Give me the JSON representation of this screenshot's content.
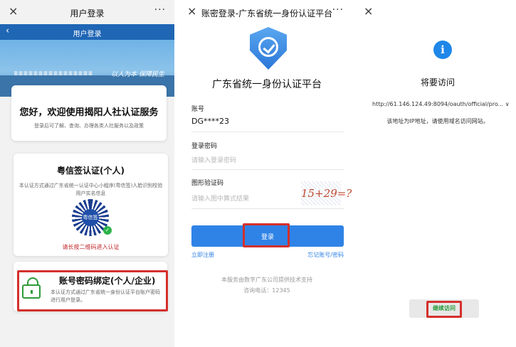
{
  "panel1": {
    "wechat_close": "×",
    "wechat_title": "用户登录",
    "wechat_more": "···",
    "nav_back": "‹",
    "nav_title": "用户登录",
    "banner_slogan": "以人为本 保障民生",
    "welcome_title": "您好，欢迎使用揭阳人社认证服务",
    "welcome_sub": "登录后可了解、查询、办理各类人社服务以及政策",
    "yxq_title": "粤信签认证(个人)",
    "yxq_desc": "本认证方式通过广东省统一认证中心小程序(粤信签)人脸识别校验用户实名信息",
    "qr_center": "粤信签",
    "yxq_hint": "请长按二维码进入认证",
    "account_title": "账号密码绑定(个人/企业)",
    "account_desc": "本认证方式通过广东省统一身份认证平台账户密码进行用户登录。"
  },
  "panel2": {
    "wechat_close": "×",
    "wechat_title": "账密登录-广东省统一身份认证平台",
    "wechat_more": "···",
    "platform_title": "广东省统一身份认证平台",
    "account_label": "账号",
    "account_value": "DG****23",
    "password_label": "登录密码",
    "password_placeholder": "请输入登录密码",
    "captcha_label": "图形验证码",
    "captcha_placeholder": "请输入图中算式结果",
    "captcha_text": "15+29=?",
    "login_button": "登录",
    "register_link": "立即注册",
    "forgot_link": "忘记账号/密码",
    "footer_line1": "本服务由数字广东公司提供技术支持",
    "footer_line2": "咨询电话：12345"
  },
  "panel3": {
    "close": "×",
    "info_glyph": "i",
    "title": "将要访问",
    "url": "http://61.146.124.49:8094/oauth/official/pro... ∨",
    "note": "该地址为IP地址，请使用域名访问网站。",
    "continue_button": "继续访问"
  },
  "colors": {
    "nav_blue": "#1f66b4",
    "primary_blue": "#2f83e6",
    "highlight_red": "#d4302c",
    "success_green": "#2f9a3a"
  },
  "icons": [
    "close-icon",
    "more-icon",
    "back-icon",
    "qr-code",
    "lock-icon",
    "shield-check-icon",
    "info-icon"
  ]
}
